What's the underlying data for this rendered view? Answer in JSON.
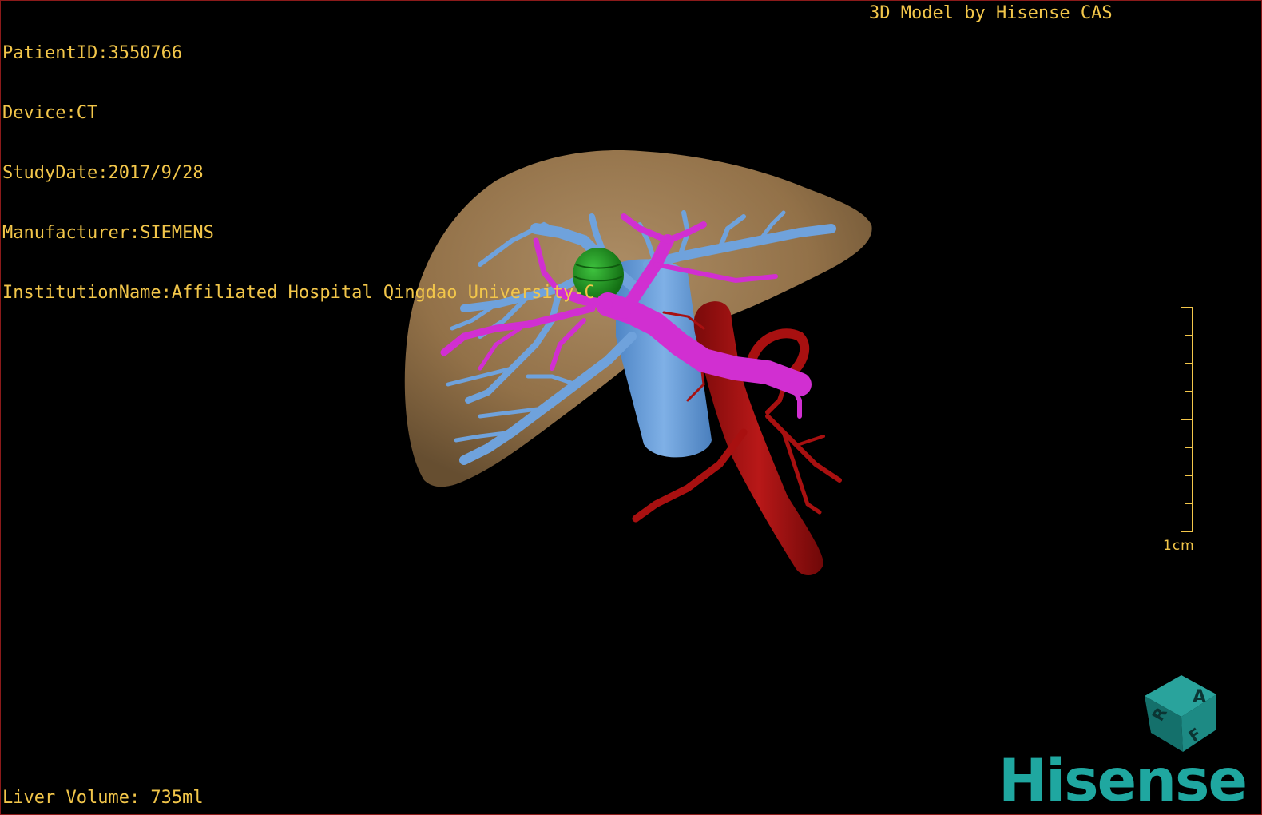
{
  "header": {
    "patient_id": "PatientID:3550766",
    "device": "Device:CT",
    "study_date": "StudyDate:2017/9/28",
    "manufacturer": "Manufacturer:SIEMENS",
    "institution": "InstitutionName:Affiliated Hospital Qingdao University-C"
  },
  "brand_credit": "3D Model by Hisense CAS",
  "footer": {
    "liver_volume": "Liver Volume: 735ml"
  },
  "scale_bar": {
    "label": "1cm"
  },
  "orientation_cube": {
    "labels": [
      "A",
      "R",
      "F"
    ]
  },
  "logo": {
    "text": "Hisense"
  },
  "colors": {
    "overlay_text": "#f2c64a",
    "liver": "#9c7b4e",
    "hepatic_vein": "#6fa2dc",
    "portal_vein": "#d12fd1",
    "artery": "#a81010",
    "tumor": "#1e9a1e",
    "logo": "#1fa7a0",
    "border": "#8b1a1a"
  }
}
